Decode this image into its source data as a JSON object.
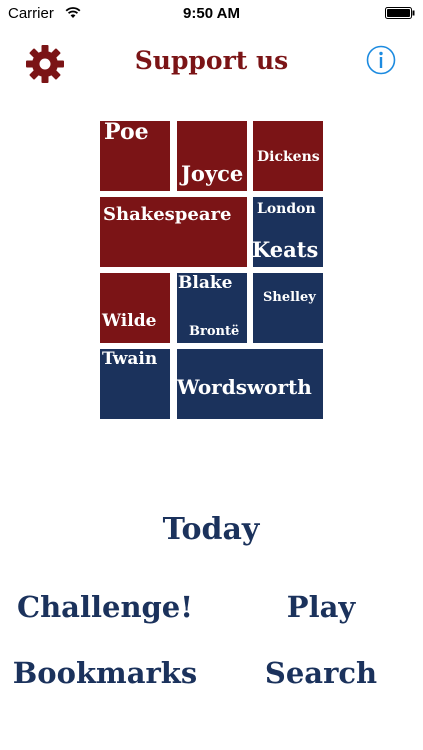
{
  "status_bar": {
    "carrier": "Carrier",
    "time": "9:50 AM",
    "icons": [
      "wifi-icon",
      "battery-icon"
    ]
  },
  "header": {
    "title": "Support us",
    "left_icon": "gear-icon",
    "right_icon": "info-icon"
  },
  "logo": {
    "words": {
      "poe": "Poe",
      "joyce": "Joyce",
      "dickens": "Dickens",
      "shakespeare": "Shakespeare",
      "london": "London",
      "keats": "Keats",
      "wilde": "Wilde",
      "blake": "Blake",
      "bronte": "Brontë",
      "shelley": "Shelley",
      "twain": "Twain",
      "wordsworth": "Wordsworth"
    }
  },
  "menu": {
    "today": "Today",
    "challenge": "Challenge!",
    "play": "Play",
    "bookmarks": "Bookmarks",
    "search": "Search"
  },
  "colors": {
    "accent_red": "#7b1416",
    "accent_blue": "#1b325c",
    "info_blue": "#1d8be0"
  }
}
